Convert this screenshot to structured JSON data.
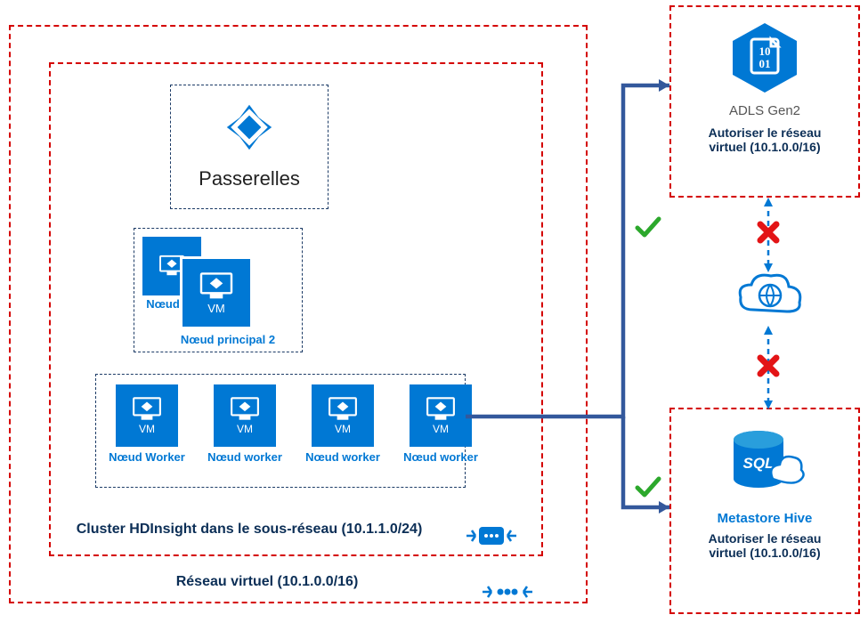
{
  "diagram": {
    "vnet": {
      "label": "Réseau virtuel (10.1.0.0/16)"
    },
    "subnet": {
      "label": "Cluster HDInsight dans le sous-réseau (10.1.1.0/24)"
    },
    "gateways": {
      "label": "Passerelles"
    },
    "head": {
      "node1": "Nœud",
      "node2": "Nœud principal 2",
      "vm": "VM"
    },
    "workers": {
      "w1": "Nœud Worker",
      "w2": "Nœud worker",
      "w3": "Nœud worker",
      "w4": "Nœud worker",
      "vm": "VM"
    },
    "adls": {
      "title": "ADLS Gen2",
      "auth": "Autoriser le réseau virtuel (10.1.0.0/16)"
    },
    "hive": {
      "title": "Metastore Hive",
      "auth": "Autoriser le réseau virtuel (10.1.0.0/16)"
    },
    "marks": {
      "check": "✓",
      "cross": "✖"
    }
  }
}
